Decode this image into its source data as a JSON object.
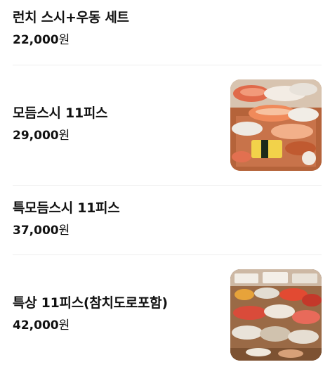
{
  "menu": {
    "items": [
      {
        "name": "런치 스시+우동 세트",
        "price": "22,000",
        "currency": "원",
        "has_image": false
      },
      {
        "name": "모듬스시 11피스",
        "price": "29,000",
        "currency": "원",
        "has_image": true,
        "image_icon": "sushi-platter-photo"
      },
      {
        "name": "특모듬스시 11피스",
        "price": "37,000",
        "currency": "원",
        "has_image": false
      },
      {
        "name": "특상 11피스(참치도로포함)",
        "price": "42,000",
        "currency": "원",
        "has_image": true,
        "image_icon": "premium-sushi-photo"
      }
    ]
  },
  "colors": {
    "text": "#111111",
    "divider": "#eeeeee",
    "background": "#ffffff"
  }
}
